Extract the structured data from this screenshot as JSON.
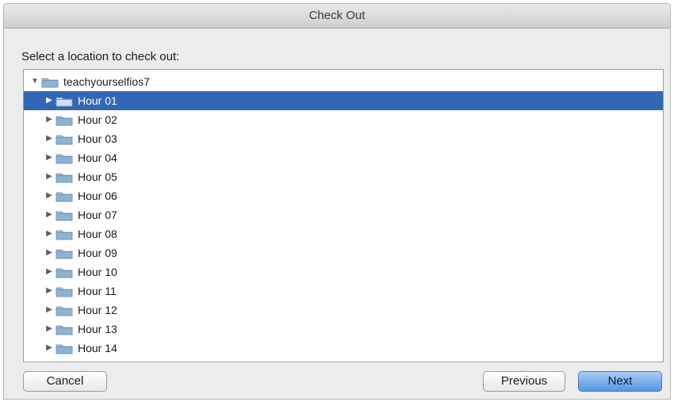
{
  "window": {
    "title": "Check Out"
  },
  "prompt": "Select a location to check out:",
  "tree": {
    "root": {
      "label": "teachyourselfios7",
      "expanded": true
    },
    "items": [
      {
        "label": "Hour 01",
        "selected": true
      },
      {
        "label": "Hour 02"
      },
      {
        "label": "Hour 03"
      },
      {
        "label": "Hour 04"
      },
      {
        "label": "Hour 05"
      },
      {
        "label": "Hour 06"
      },
      {
        "label": "Hour 07"
      },
      {
        "label": "Hour 08"
      },
      {
        "label": "Hour 09"
      },
      {
        "label": "Hour 10"
      },
      {
        "label": "Hour 11"
      },
      {
        "label": "Hour 12"
      },
      {
        "label": "Hour 13"
      },
      {
        "label": "Hour 14"
      }
    ],
    "icons": {
      "expanded": "triangle-down-icon",
      "collapsed": "triangle-right-icon",
      "folder": "folder-icon"
    }
  },
  "buttons": {
    "cancel": "Cancel",
    "previous": "Previous",
    "next": "Next"
  },
  "colors": {
    "selection": "#3466b6",
    "primary_button": "#5795e4",
    "folder": "#8fb3d3"
  }
}
